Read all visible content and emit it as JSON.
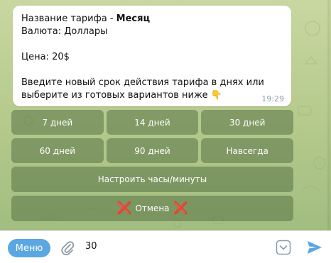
{
  "message": {
    "line1_label": "Название тарифа - ",
    "line1_value": "Месяц",
    "line2": "Валюта: Доллары",
    "line3": "Цена: 20$",
    "line4": "Введите новый срок действия тарифа в днях или выберите из готовых вариантов ниже 👇",
    "time": "19:29"
  },
  "keyboard": {
    "row1": [
      "7 дней",
      "14 дней",
      "30 дней"
    ],
    "row2": [
      "60 дней",
      "90 дней",
      "Навсегда"
    ],
    "row3": "Настроить часы/минуты",
    "cancel": "Отмена",
    "cancel_icon": "❌"
  },
  "input": {
    "menu_label": "Меню",
    "value": "30"
  },
  "colors": {
    "menu_button": "#5aa7e2",
    "send_icon": "#5aa7e2",
    "keyboard_button": "#587346",
    "cancel_icon": "#e01d1d"
  },
  "icons": {
    "attach": "paperclip-icon",
    "keyboard_toggle": "keyboard-toggle-icon",
    "send": "send-icon"
  }
}
